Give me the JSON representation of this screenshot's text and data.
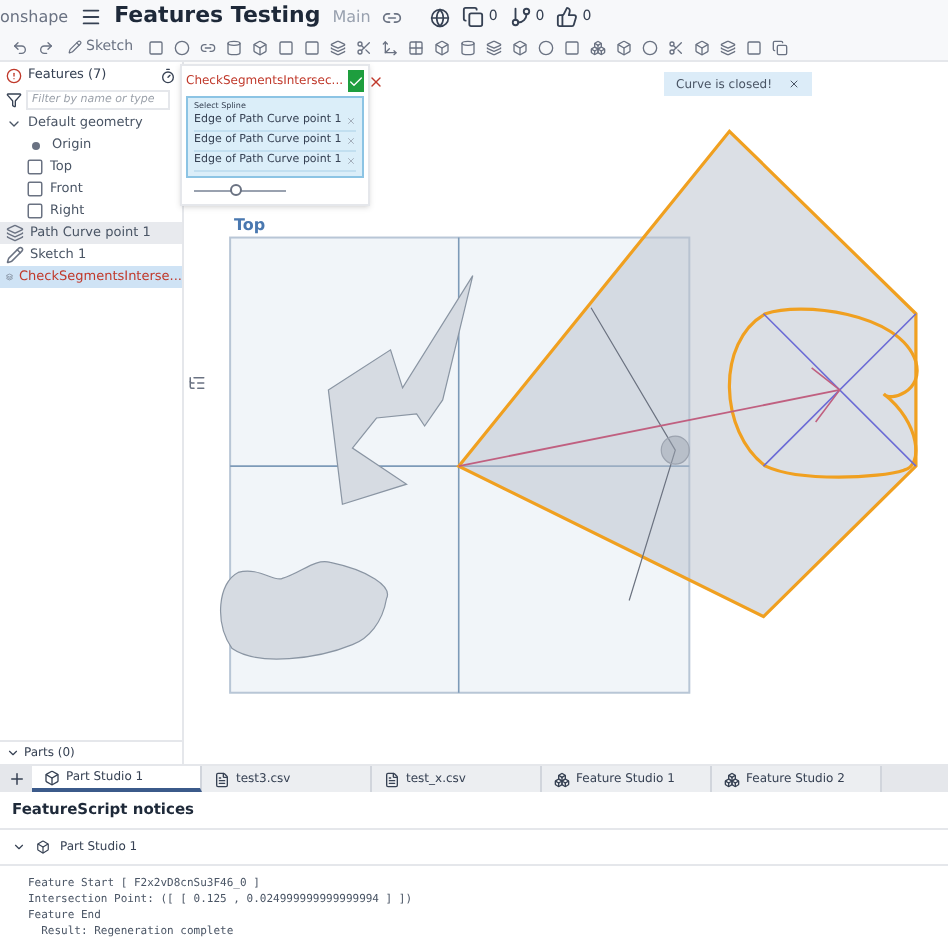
{
  "app_bar": {
    "brand": "onshape",
    "document_title": "Features Testing",
    "branch": "Main",
    "counts": [
      {
        "kind": "versions",
        "value": "0"
      },
      {
        "kind": "branches",
        "value": "0"
      },
      {
        "kind": "likes",
        "value": "0"
      }
    ]
  },
  "toolbar": {
    "sketch_label": "Sketch"
  },
  "feature_panel": {
    "title": "Features (7)",
    "filter_placeholder": "Filter by name or type",
    "tree": [
      {
        "label": "Default geometry",
        "kind": "folder",
        "expanded": true,
        "selected": false,
        "children": [
          {
            "label": "Origin",
            "kind": "origin",
            "selected": false
          },
          {
            "label": "Top",
            "kind": "plane",
            "selected": false
          },
          {
            "label": "Front",
            "kind": "plane",
            "selected": false
          },
          {
            "label": "Right",
            "kind": "plane",
            "selected": false
          }
        ]
      },
      {
        "label": "Path Curve point 1",
        "kind": "feature",
        "selected": false,
        "highlighted": true
      },
      {
        "label": "Sketch 1",
        "kind": "sketch",
        "selected": false,
        "highlighted": false
      },
      {
        "label": "CheckSegmentsInterse...",
        "kind": "feature",
        "selected": true,
        "highlighted": false,
        "error": true
      }
    ],
    "parts": {
      "label": "Parts (0)",
      "expanded": true
    }
  },
  "feature_dialog": {
    "title": "CheckSegmentsIntersec...",
    "selection_label": "Select Spline",
    "selections": [
      "Edge of Path Curve point 1",
      "Edge of Path Curve point 1",
      "Edge of Path Curve point 1"
    ],
    "slider": {
      "level": 0.45
    }
  },
  "toast": {
    "message": "Curve is closed!"
  },
  "viewport": {
    "plane_label": "Top"
  },
  "tabs": [
    {
      "label": "Part Studio 1",
      "kind": "partstudio",
      "selected": true
    },
    {
      "label": "test3.csv",
      "kind": "file",
      "selected": false
    },
    {
      "label": "test_x.csv",
      "kind": "file",
      "selected": false
    },
    {
      "label": "Feature Studio 1",
      "kind": "featurestudio",
      "selected": false
    },
    {
      "label": "Feature Studio 2",
      "kind": "featurestudio",
      "selected": false
    }
  ],
  "notices": {
    "title": "FeatureScript notices",
    "group": {
      "label": "Part Studio 1",
      "expanded": true
    },
    "lines": [
      "Feature Start [ F2x2vD8cnSu3F46_0 ]",
      "Intersection Point: ([ [ 0.125 , 0.024999999999999994 ] ])",
      "Feature End",
      "  Result: Regeneration complete"
    ]
  }
}
